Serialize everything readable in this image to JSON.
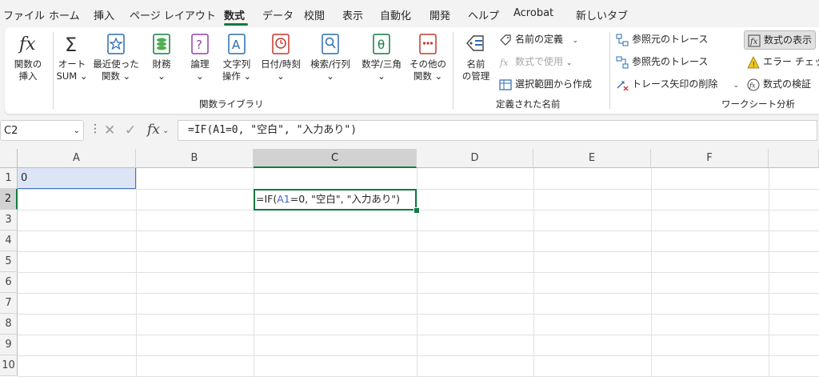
{
  "tabs": [
    "ファイル",
    "ホーム",
    "挿入",
    "ページ レイアウト",
    "数式",
    "データ",
    "校閲",
    "表示",
    "自動化",
    "開発",
    "ヘルプ",
    "Acrobat",
    "新しいタブ"
  ],
  "active_tab": "数式",
  "ribbon": {
    "library": {
      "insert_function": [
        "関数の",
        "挿入"
      ],
      "autosum": [
        "オート",
        "SUM ⌄"
      ],
      "recent": [
        "最近使った",
        "関数 ⌄"
      ],
      "financial": [
        "財務",
        "⌄"
      ],
      "logical": [
        "論理",
        "⌄"
      ],
      "text": [
        "文字列",
        "操作 ⌄"
      ],
      "datetime": [
        "日付/時刻",
        "⌄"
      ],
      "lookup": [
        "検索/行列",
        "⌄"
      ],
      "math": [
        "数学/三角",
        "⌄"
      ],
      "more": [
        "その他の",
        "関数 ⌄"
      ],
      "group_label": "関数ライブラリ"
    },
    "names": {
      "name_manager": [
        "名前",
        "の管理"
      ],
      "define_name": "名前の定義",
      "use_in_formula": "数式で使用",
      "create_from_selection": "選択範囲から作成",
      "group_label": "定義された名前"
    },
    "audit": {
      "trace_precedents": "参照元のトレース",
      "trace_dependents": "参照先のトレース",
      "remove_arrows": "トレース矢印の削除",
      "show_formulas": "数式の表示",
      "error_check": "エラー チェック",
      "evaluate": "数式の検証",
      "group_label": "ワークシート分析"
    }
  },
  "formula_bar": {
    "name_box": "C2",
    "formula": "=IF(A1=0, \"空白\", \"入力あり\")"
  },
  "sheet": {
    "columns": [
      "A",
      "B",
      "C",
      "D",
      "E",
      "F"
    ],
    "rows": [
      "1",
      "2",
      "3",
      "4",
      "5",
      "6",
      "7",
      "8",
      "9",
      "10"
    ],
    "a1_value": "0",
    "c2_parts": [
      "=IF(",
      "A1",
      "=0, \"空白\", \"入力あり\")"
    ]
  },
  "colors": {
    "excel_green": "#107c41",
    "selection_blue": "#dbe5f6",
    "ref_blue": "#3b66c8"
  }
}
